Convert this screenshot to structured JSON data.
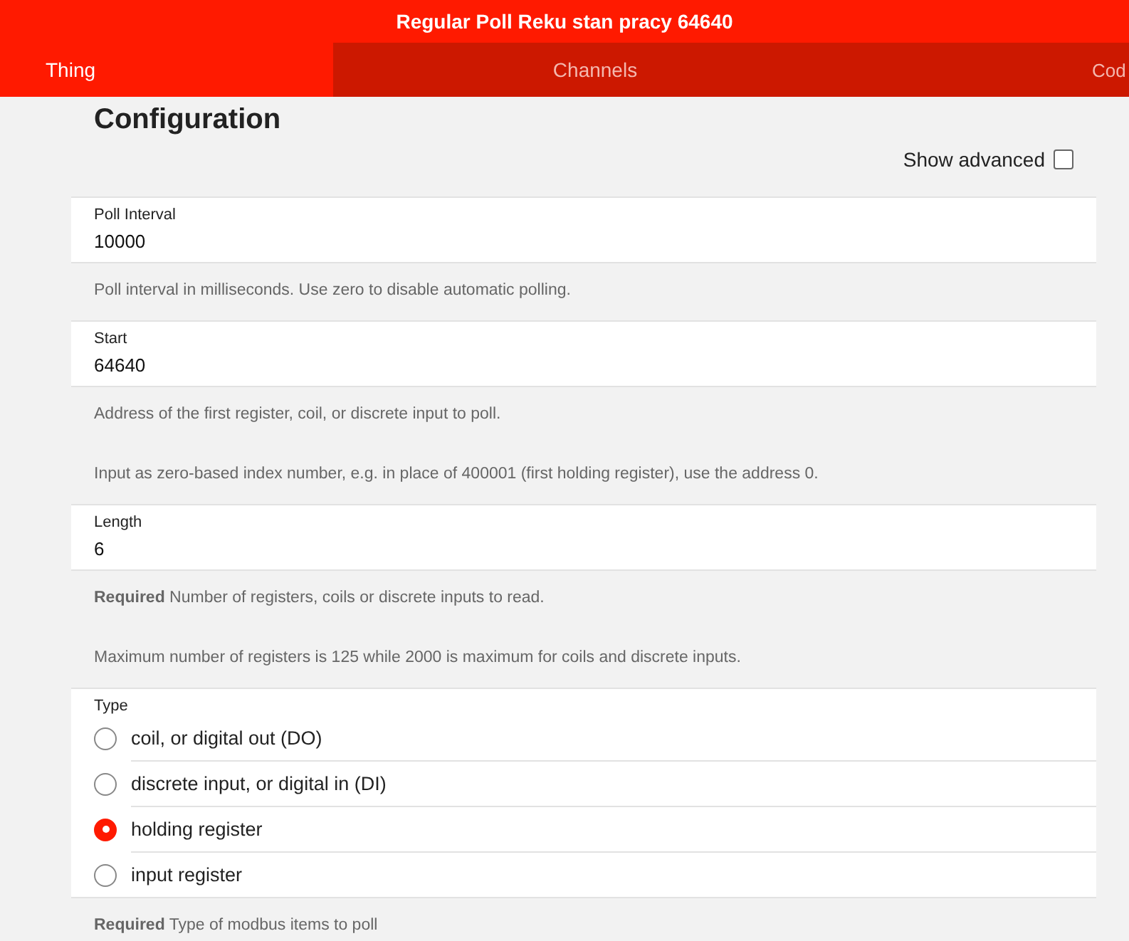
{
  "header": {
    "title": "Regular Poll Reku stan pracy 64640"
  },
  "tabs": [
    {
      "label": "Thing",
      "selected": true
    },
    {
      "label": "Channels",
      "selected": false
    },
    {
      "label": "Cod",
      "selected": false
    }
  ],
  "section_title": "Configuration",
  "show_advanced": {
    "label": "Show advanced",
    "checked": false
  },
  "parameters": [
    {
      "kind": "text",
      "label": "Poll Interval",
      "value": "10000",
      "description": [
        "Poll interval in milliseconds. Use zero to disable automatic polling."
      ]
    },
    {
      "kind": "text",
      "label": "Start",
      "value": "64640",
      "description": [
        "Address of the first register, coil, or discrete input to poll.",
        "Input as zero-based index number, e.g. in place of 400001 (first holding register), use the address 0."
      ]
    },
    {
      "kind": "text",
      "label": "Length",
      "value": "6",
      "description": [
        "**Required** Number of registers, coils or discrete inputs to read.",
        "Maximum number of registers is 125 while 2000 is maximum for coils and discrete inputs."
      ]
    },
    {
      "kind": "radio",
      "label": "Type",
      "options": [
        {
          "label": "coil, or digital out (DO)",
          "selected": false
        },
        {
          "label": "discrete input, or digital in (DI)",
          "selected": false
        },
        {
          "label": "holding register",
          "selected": true
        },
        {
          "label": "input register",
          "selected": false
        }
      ],
      "description": [
        "**Required** Type of modbus items to poll"
      ]
    }
  ]
}
